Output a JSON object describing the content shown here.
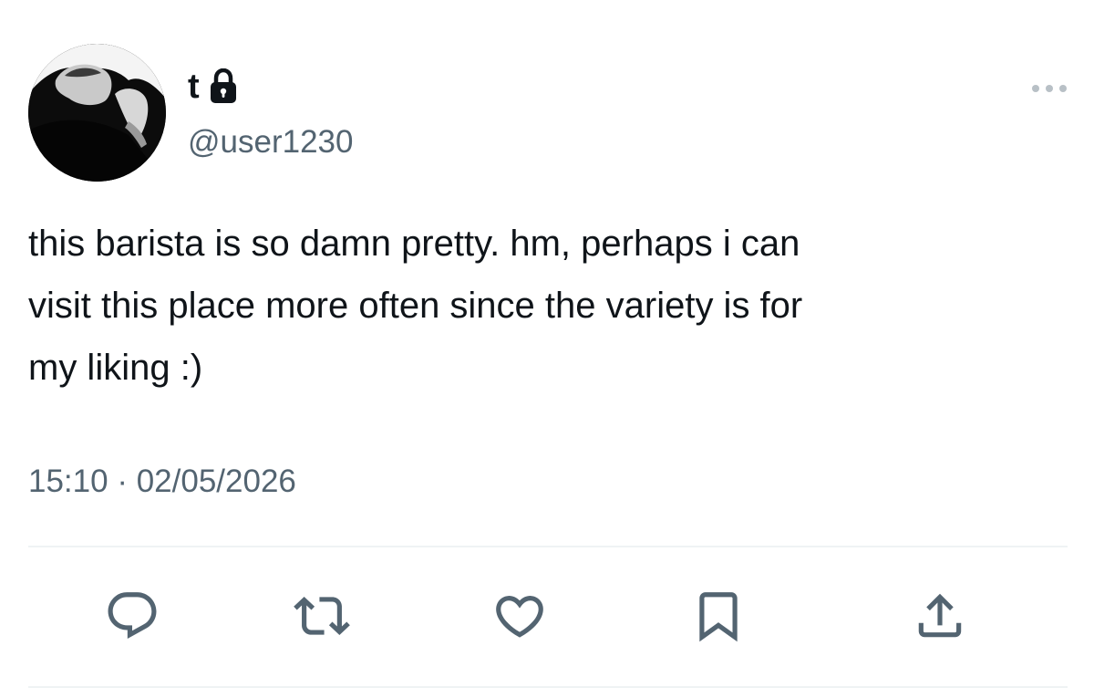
{
  "user": {
    "display_name": "t",
    "handle": "@user1230",
    "protected_icon": "lock-icon",
    "avatar": "profile-photo"
  },
  "tweet": {
    "text": "this barista is so damn pretty. hm, perhaps i can\nvisit this place more often since the variety is for\nmy liking :)",
    "time": "15:10",
    "separator": "·",
    "date": "02/05/2026"
  },
  "actions": [
    {
      "name": "reply",
      "icon": "reply-icon"
    },
    {
      "name": "retweet",
      "icon": "retweet-icon"
    },
    {
      "name": "like",
      "icon": "heart-icon"
    },
    {
      "name": "bookmark",
      "icon": "bookmark-icon"
    },
    {
      "name": "share",
      "icon": "share-icon"
    }
  ],
  "colors": {
    "text": "#0f1419",
    "secondary_text": "#536471",
    "icon": "#536471",
    "divider": "#eff3f4",
    "more_icon": "#b8c0c6"
  }
}
